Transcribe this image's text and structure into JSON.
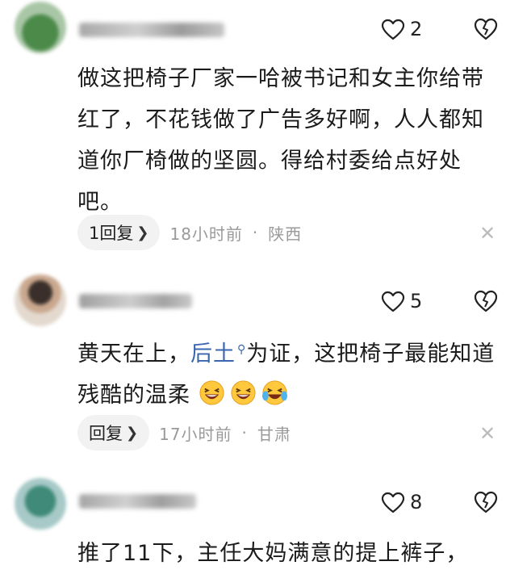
{
  "comments": [
    {
      "like_count": "2",
      "text": "做这把椅子厂家一哈被书记和女主你给带红了，不花钱做了广告多好啊，人人都知道你厂椅做的坚圆。得给村委给点好处吧。",
      "reply_label": "1回复",
      "time": "18小时前",
      "location": "陕西"
    },
    {
      "like_count": "5",
      "text_before": "黄天在上，",
      "link_text": "后土",
      "text_after": "为证，这把椅子最能知道残酷的温柔",
      "reply_label": "回复",
      "time": "17小时前",
      "location": "甘肃"
    },
    {
      "like_count": "8",
      "text": "推了11下，主任大妈满意的提上裤子，"
    }
  ],
  "meta_separator": "·",
  "icons": {
    "like": "heart-icon",
    "dislike": "broken-heart-icon",
    "close": "close-icon",
    "search": "search-icon",
    "chevron": "chevron-right-icon",
    "emoji": "laughing-emoji"
  },
  "colors": {
    "link": "#3a66b0",
    "meta": "#9a9a9a",
    "pill": "#f2f2f2"
  }
}
